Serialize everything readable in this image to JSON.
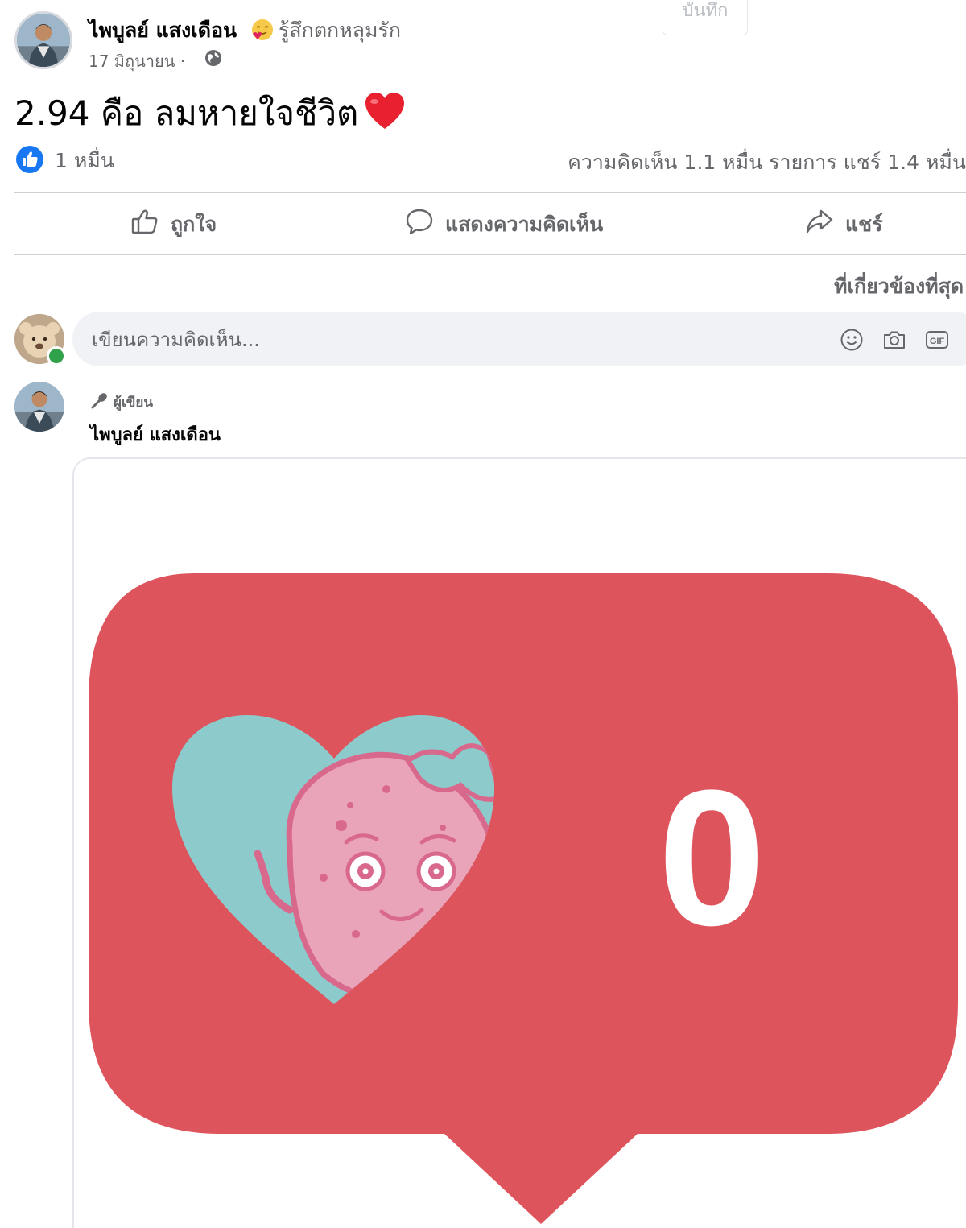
{
  "post": {
    "author_name": "ไพบูลย์ แสงเดือน",
    "feeling": "รู้สึกตกหลุมรัก",
    "save_label": "บันทึก",
    "date": "17 มิถุนายน ·",
    "text": "2.94 คือ ลมหายใจชีวิต"
  },
  "stats": {
    "likes": "1 หมื่น",
    "comments_shares": "ความคิดเห็น 1.1 หมื่น รายการ  แชร์ 1.4 หมื่น"
  },
  "actions": {
    "like": "ถูกใจ",
    "comment": "แสดงความคิดเห็น",
    "share": "แชร์"
  },
  "sort_label": "ที่เกี่ยวข้องที่สุด",
  "composer": {
    "placeholder": "เขียนความคิดเห็น..."
  },
  "comment": {
    "author_tag": "ผู้เขียน",
    "author_name": "ไพบูลย์ แสงเดือน",
    "image_counter": "0"
  },
  "colors": {
    "facebook_blue": "#1877f2",
    "like_bubble": "#de545c",
    "heart_teal": "#8ccacb",
    "character_pink": "#e9a4ba",
    "online_green": "#31a24c"
  }
}
